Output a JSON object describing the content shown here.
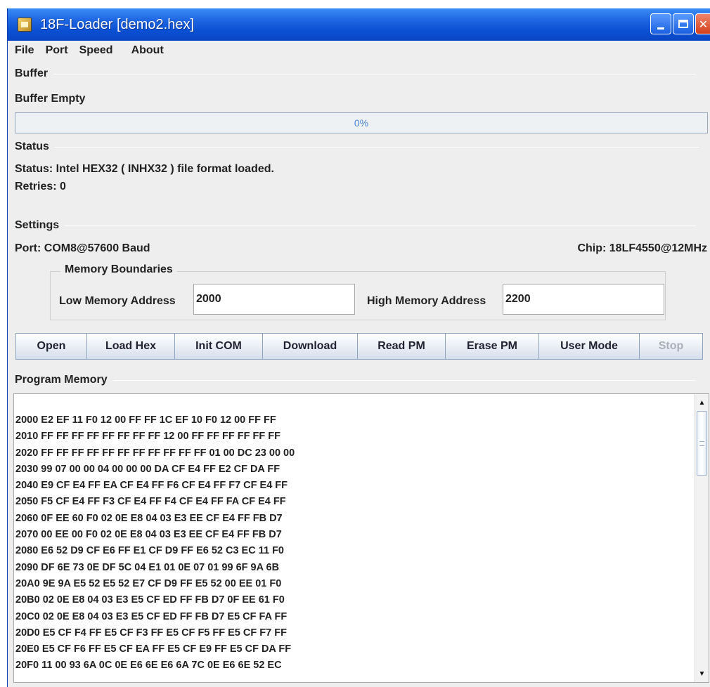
{
  "window": {
    "title": "18F-Loader [demo2.hex]"
  },
  "menu": [
    "File",
    "Port",
    "Speed",
    "About"
  ],
  "buffer": {
    "section_title": "Buffer",
    "state": "Buffer Empty",
    "progress_text": "0%",
    "progress": 0
  },
  "status": {
    "section_title": "Status",
    "message": "Status: Intel HEX32 ( INHX32 ) file format loaded.",
    "retries": "Retries: 0"
  },
  "settings": {
    "section_title": "Settings",
    "port": "Port: COM8@57600 Baud",
    "chip": "Chip: 18LF4550@12MHz",
    "memory_boundaries": {
      "title": "Memory Boundaries",
      "low_label": "Low Memory Address",
      "low_value": "2000",
      "high_label": "High Memory Address",
      "high_value": "2200"
    }
  },
  "buttons": [
    "Open",
    "Load Hex",
    "Init COM",
    "Download",
    "Read PM",
    "Erase PM",
    "User Mode",
    "Stop"
  ],
  "program_memory": {
    "title": "Program Memory",
    "lines": [
      "2000 E2 EF 11 F0 12 00 FF FF 1C EF 10 F0 12 00 FF FF",
      "2010 FF FF FF FF FF FF FF FF 12 00 FF FF FF FF FF FF",
      "2020 FF FF FF FF FF FF FF FF FF FF FF 01 00 DC 23 00 00",
      "2030 99 07 00 00 04 00 00 00 DA CF E4 FF E2 CF DA FF",
      "2040 E9 CF E4 FF EA CF E4 FF F6 CF E4 FF F7 CF E4 FF",
      "2050 F5 CF E4 FF F3 CF E4 FF F4 CF E4 FF FA CF E4 FF",
      "2060 0F EE 60 F0 02 0E E8 04 03 E3 EE CF E4 FF FB D7",
      "2070 00 EE 00 F0 02 0E E8 04 03 E3 EE CF E4 FF FB D7",
      "2080 E6 52 D9 CF E6 FF E1 CF D9 FF E6 52 C3 EC 11 F0",
      "2090 DF 6E 73 0E DF 5C 04 E1 01 0E 07 01 99 6F 9A 6B",
      "20A0 9E 9A E5 52 E5 52 E7 CF D9 FF E5 52 00 EE 01 F0",
      "20B0 02 0E E8 04 03 E3 E5 CF ED FF FB D7 0F EE 61 F0",
      "20C0 02 0E E8 04 03 E3 E5 CF ED FF FB D7 E5 CF FA FF",
      "20D0 E5 CF F4 FF E5 CF F3 FF E5 CF F5 FF E5 CF F7 FF",
      "20E0 E5 CF F6 FF E5 CF EA FF E5 CF E9 FF E5 CF DA FF",
      "20F0 11 00 93 6A 0C 0E E6 6E E6 6A 7C 0E E6 6E 52 EC"
    ]
  },
  "colors": {
    "title_bar": "#0a4fd3",
    "progress_text": "#4d86d6",
    "window_bg": "#eeeeee"
  }
}
